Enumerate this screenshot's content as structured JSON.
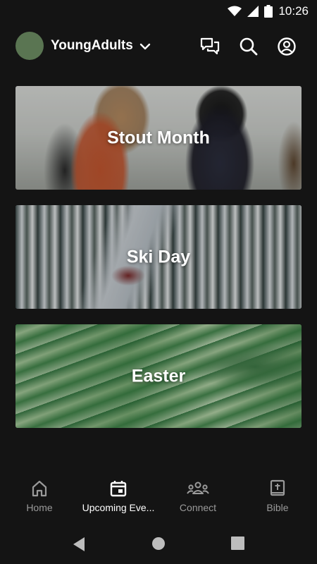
{
  "status_bar": {
    "time": "10:26",
    "icons": [
      "wifi-icon",
      "signal-icon",
      "battery-icon"
    ]
  },
  "header": {
    "group_name": "YoungAdults",
    "avatar_color": "#5a7552",
    "icons": [
      "chat-icon",
      "search-icon",
      "account-icon"
    ]
  },
  "events": [
    {
      "title": "Stout Month"
    },
    {
      "title": "Ski Day"
    },
    {
      "title": "Easter"
    }
  ],
  "bottom_nav": {
    "items": [
      {
        "label": "Home",
        "icon": "home-icon",
        "active": false
      },
      {
        "label": "Upcoming Eve...",
        "icon": "calendar-icon",
        "active": true
      },
      {
        "label": "Connect",
        "icon": "group-icon",
        "active": false
      },
      {
        "label": "Bible",
        "icon": "bible-icon",
        "active": false
      }
    ]
  },
  "system_nav": [
    "back-button",
    "home-button",
    "recents-button"
  ],
  "colors": {
    "background": "#141414",
    "active": "#ffffff",
    "inactive": "#9a9a9a"
  }
}
